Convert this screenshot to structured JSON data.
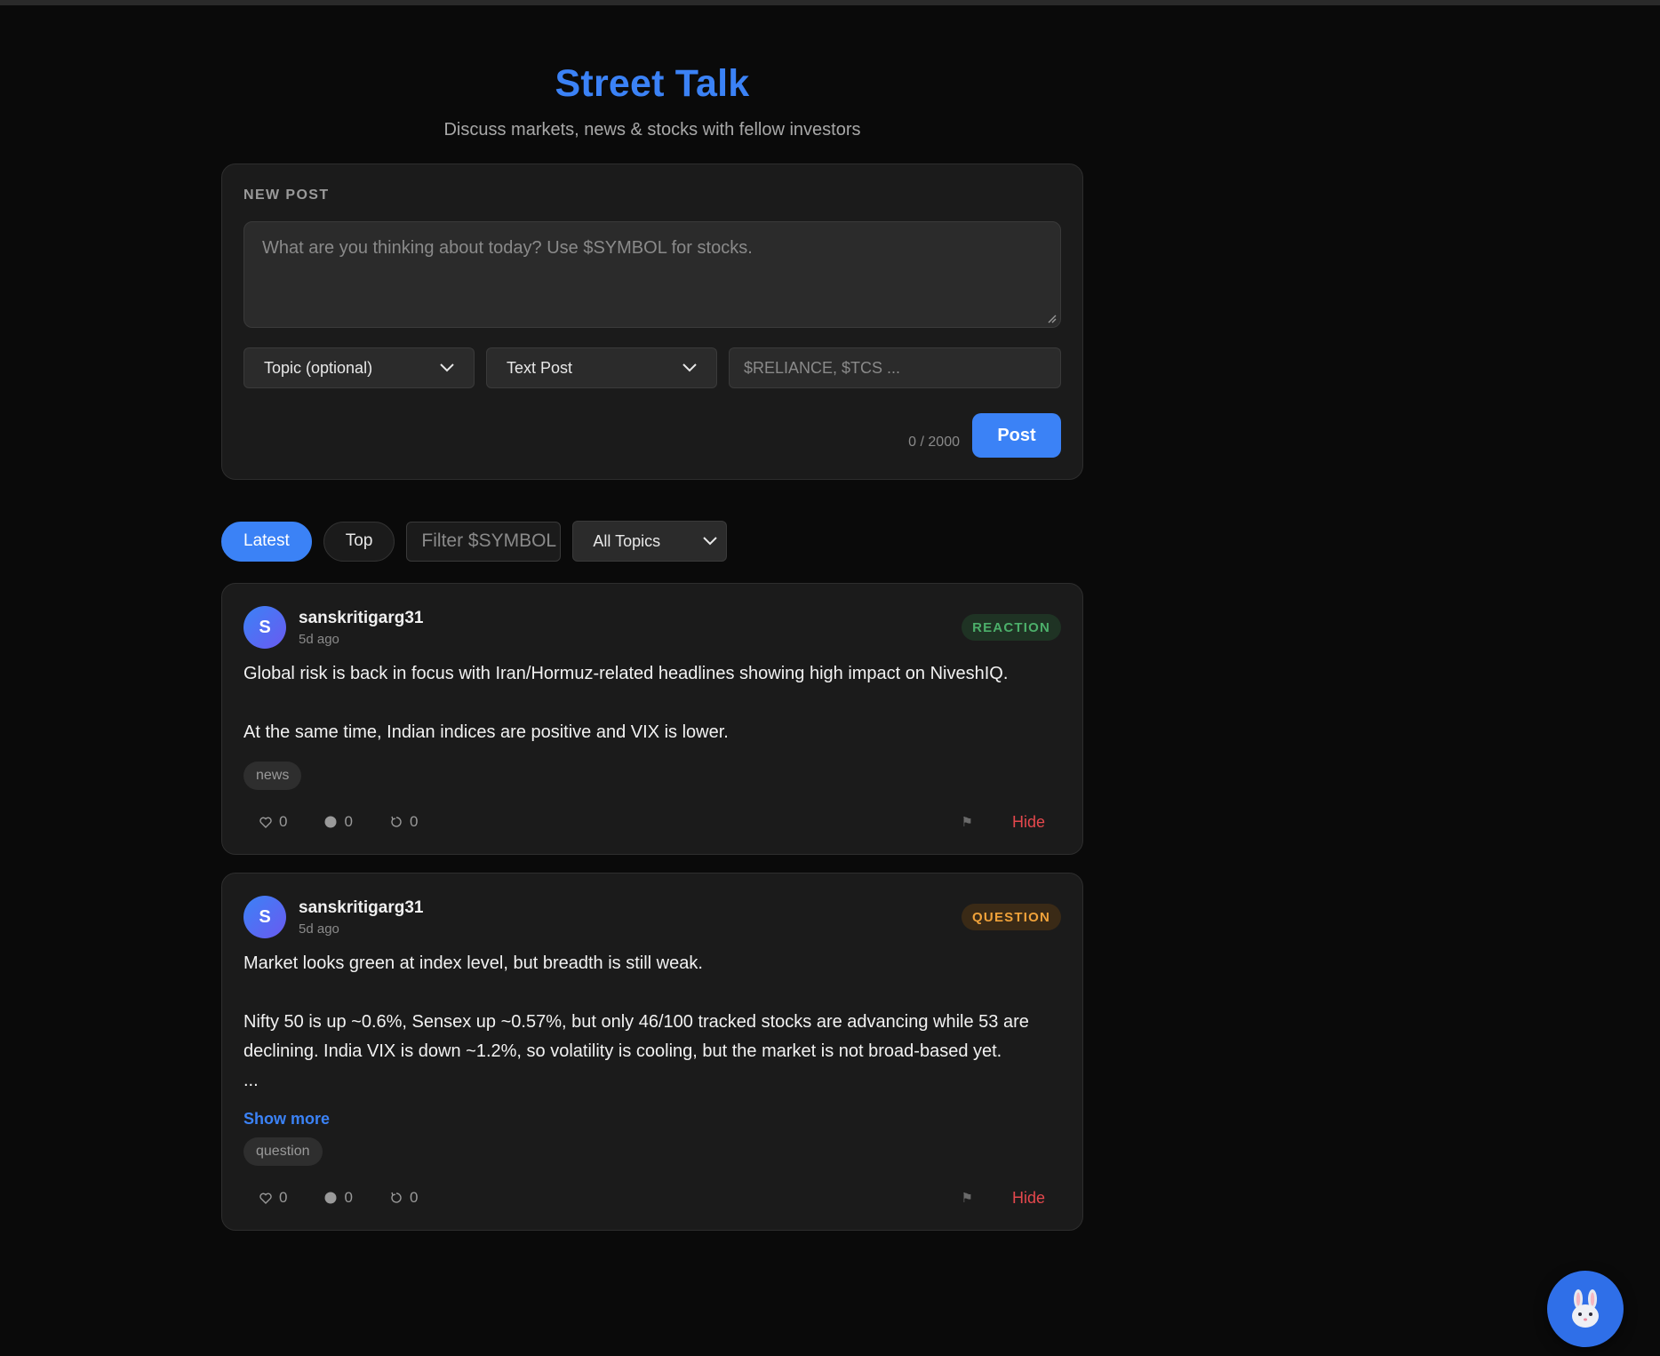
{
  "header": {
    "title": "Street Talk",
    "subtitle": "Discuss markets, news & stocks with fellow investors"
  },
  "composer": {
    "section_label": "NEW POST",
    "textarea_placeholder": "What are you thinking about today? Use $SYMBOL for stocks.",
    "topic_select": "Topic (optional)",
    "type_select": "Text Post",
    "symbols_placeholder": "$RELIANCE, $TCS ...",
    "counter": "0 / 2000",
    "post_label": "Post"
  },
  "filters": {
    "latest_label": "Latest",
    "top_label": "Top",
    "symbol_placeholder": "Filter $SYMBOL",
    "topics_select": "All Topics"
  },
  "posts": [
    {
      "avatar_initial": "S",
      "author": "sanskritigarg31",
      "time": "5d ago",
      "badge": "REACTION",
      "body": "Global risk is back in focus with Iran/Hormuz-related headlines showing high impact on NiveshIQ.\n\nAt the same time, Indian indices are positive and VIX is lower.",
      "tag": "news",
      "likes": "0",
      "comments": "0",
      "reposts": "0",
      "flag": "⚑",
      "hide_label": "Hide"
    },
    {
      "avatar_initial": "S",
      "author": "sanskritigarg31",
      "time": "5d ago",
      "badge": "QUESTION",
      "body": "Market looks green at index level, but breadth is still weak.\n\nNifty 50 is up ~0.6%, Sensex up ~0.57%, but only 46/100 tracked stocks are advancing while 53 are declining. India VIX is down ~1.2%, so volatility is cooling, but the market is not broad-based yet.\n...",
      "show_more": "Show more",
      "tag": "question",
      "likes": "0",
      "comments": "0",
      "reposts": "0",
      "flag": "⚑",
      "hide_label": "Hide"
    }
  ],
  "colors": {
    "accent": "#3b82f6",
    "background": "#0a0a0a",
    "card": "#1b1b1b",
    "danger": "#e5484d",
    "reaction": "#4caf6a",
    "question": "#f0a23a"
  },
  "fab": {
    "icon": "rabbit-icon"
  }
}
